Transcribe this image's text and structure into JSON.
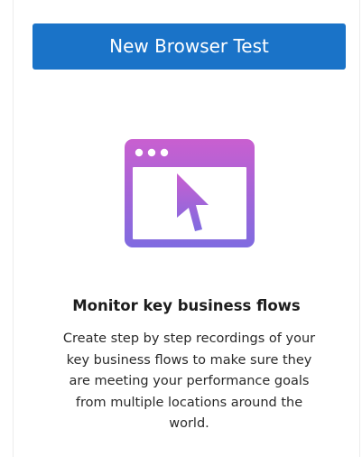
{
  "card": {
    "button_label": "New Browser Test",
    "illustration_icon": "browser-window-cursor-icon",
    "heading": "Monitor key business flows",
    "description": "Create step by step recordings of your key business flows to make sure they are meeting your performance goals from multiple locations around the world."
  },
  "colors": {
    "button_background": "#1a73c8",
    "illustration_gradient_top": "#c95fd0",
    "illustration_gradient_bottom": "#7f6be0"
  }
}
